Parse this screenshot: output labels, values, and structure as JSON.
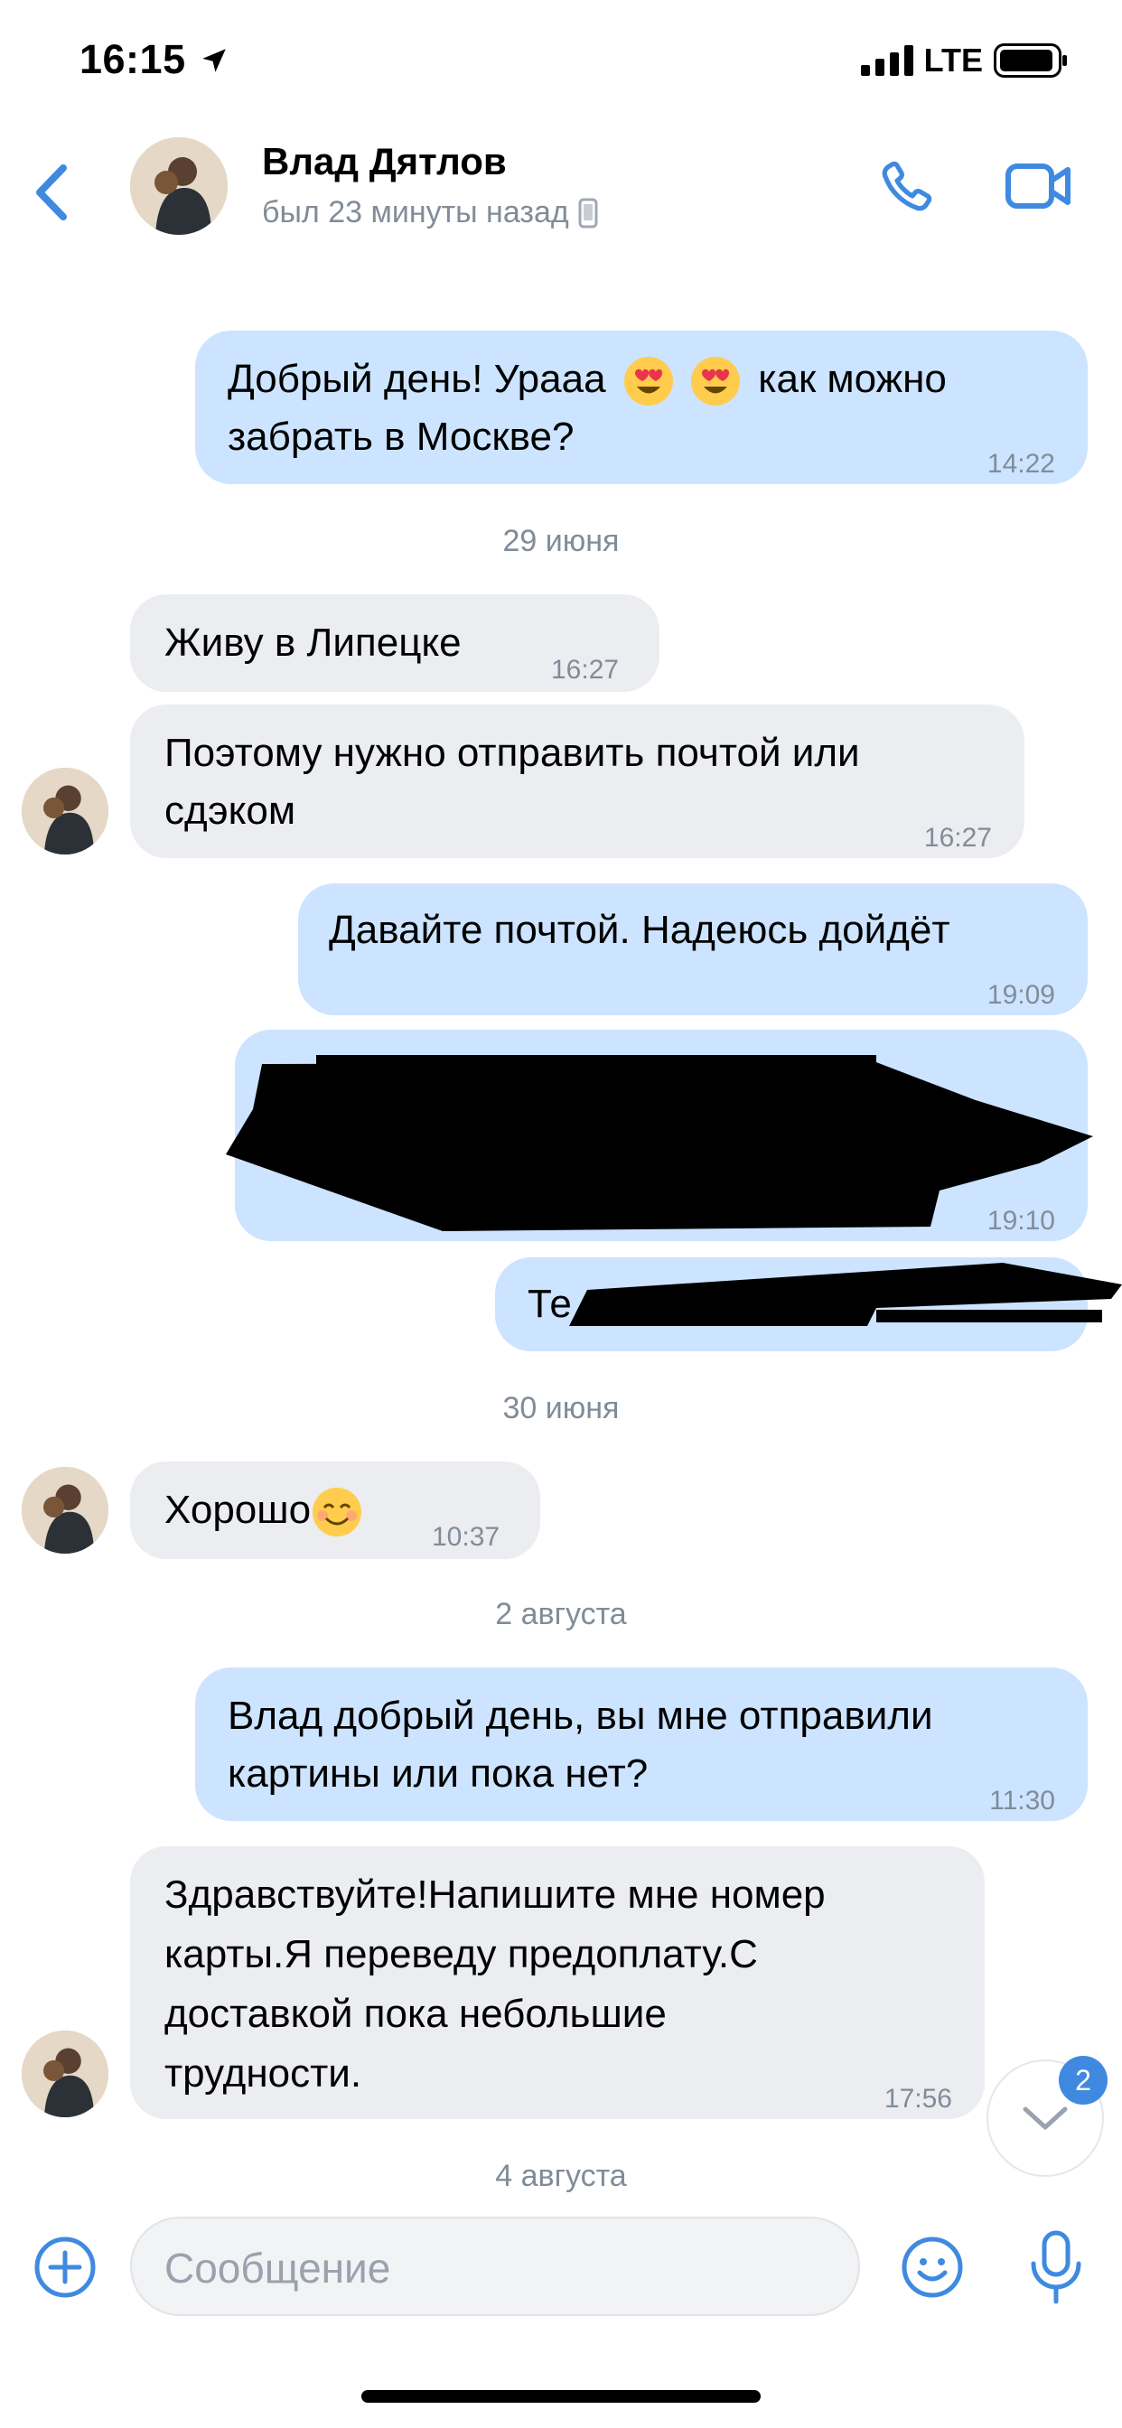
{
  "status": {
    "time": "16:15",
    "network": "LTE"
  },
  "header": {
    "name": "Влад Дятлов",
    "last_seen": "был 23 минуты назад",
    "back_label": "",
    "icons": [
      "chevron-left-icon",
      "avatar",
      "phone-icon",
      "video-icon"
    ]
  },
  "messages": {
    "m1": {
      "line1": "Добрый день! Урааа",
      "line1b": "как можно",
      "line2": "забрать в Москве?",
      "time": "14:22"
    },
    "d1": "29 июня",
    "m2": {
      "text": "Живу в Липецке",
      "time": "16:27"
    },
    "m3": {
      "line1": "Поэтому нужно отправить почтой или",
      "line2": "сдэком",
      "time": "16:27"
    },
    "m4": {
      "text": "Давайте почтой. Надеюсь дойдёт",
      "time": "19:09"
    },
    "m5": {
      "time": "19:10"
    },
    "m6": {
      "text": "Те"
    },
    "d2": "30 июня",
    "m7": {
      "text": "Хорошо",
      "time": "10:37"
    },
    "d3": "2 августа",
    "m8": {
      "line1": "Влад добрый день, вы мне отправили",
      "line2": "картины или пока нет?",
      "time": "11:30"
    },
    "m9": {
      "line1": "Здравствуйте!Напишите мне номер",
      "line2": "карты.Я переведу предоплату.С",
      "line3": "доставкой пока небольшие",
      "line4": "трудности.",
      "time": "17:56"
    },
    "d4": "4 августа"
  },
  "scroll": {
    "unread": "2"
  },
  "composer": {
    "placeholder": "Сообщение"
  },
  "colors": {
    "accent": "#3f8ae0",
    "outgoing": "#cce4ff",
    "incoming": "#ebedf0",
    "secondary": "#818c99"
  }
}
